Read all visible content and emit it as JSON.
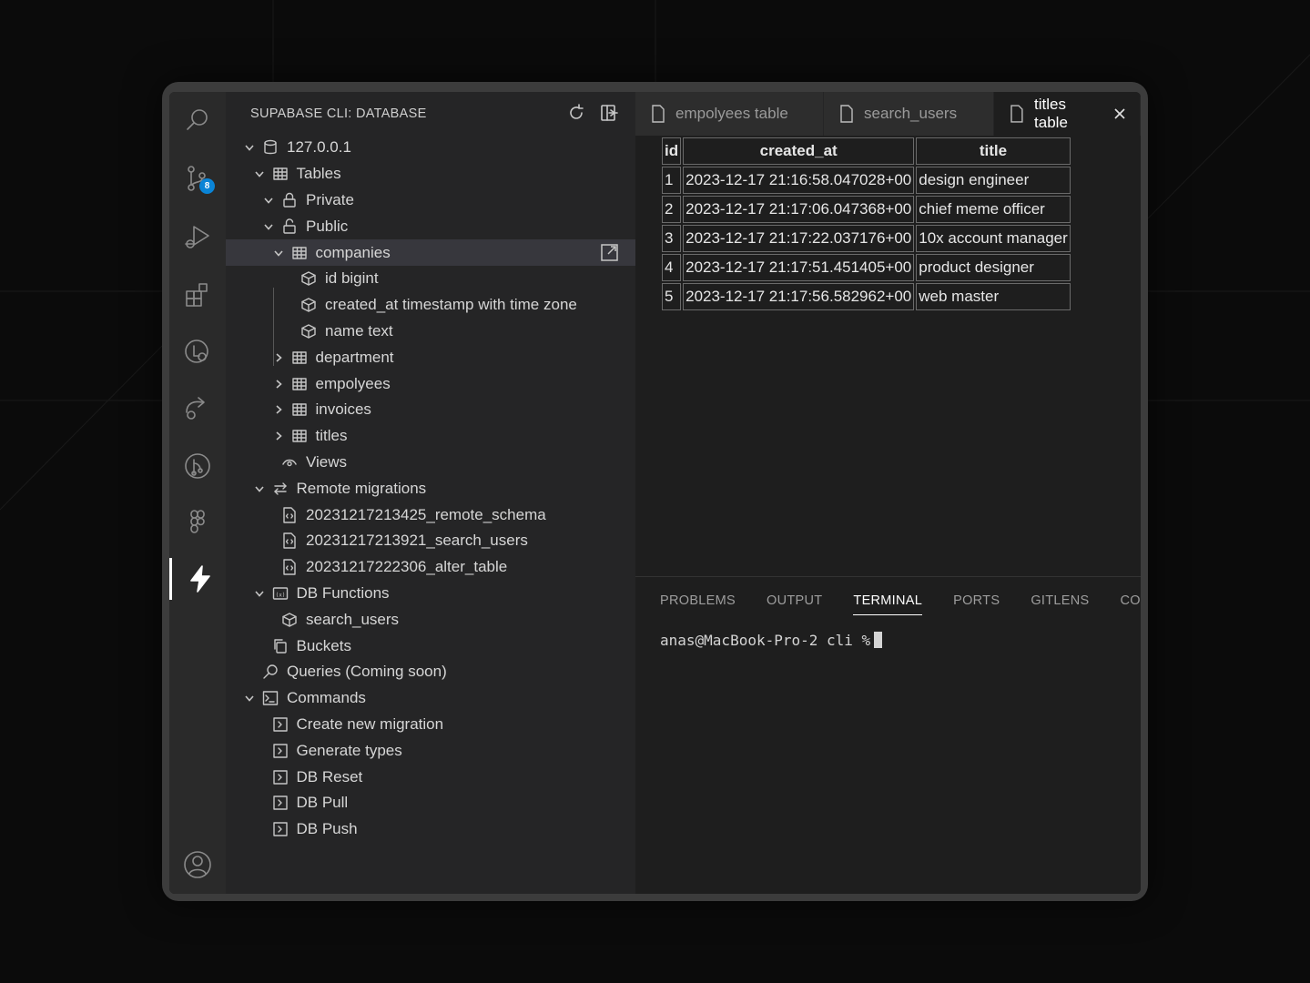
{
  "sidebar": {
    "title": "SUPABASE CLI: DATABASE",
    "tree": [
      {
        "label": "127.0.0.1",
        "icon": "database-icon",
        "chevron": "down",
        "level": 0
      },
      {
        "label": "Tables",
        "icon": "table-icon",
        "chevron": "down",
        "level": 1
      },
      {
        "label": "Private",
        "icon": "lock-icon",
        "chevron": "down",
        "level": 2
      },
      {
        "label": "Public",
        "icon": "unlock-icon",
        "chevron": "down",
        "level": 2
      },
      {
        "label": "companies",
        "icon": "table-icon",
        "chevron": "down",
        "level": 3,
        "selected": true
      },
      {
        "label": "id bigint",
        "icon": "column-icon",
        "chevron": "none",
        "level": 4
      },
      {
        "label": "created_at timestamp with time zone",
        "icon": "column-icon",
        "chevron": "none",
        "level": 4
      },
      {
        "label": "name text",
        "icon": "column-icon",
        "chevron": "none",
        "level": 4
      },
      {
        "label": "department",
        "icon": "table-icon",
        "chevron": "right",
        "level": 3
      },
      {
        "label": "empolyees",
        "icon": "table-icon",
        "chevron": "right",
        "level": 3
      },
      {
        "label": "invoices",
        "icon": "table-icon",
        "chevron": "right",
        "level": 3
      },
      {
        "label": "titles",
        "icon": "table-icon",
        "chevron": "right",
        "level": 3
      },
      {
        "label": "Views",
        "icon": "eye-icon",
        "chevron": "none",
        "level": 2
      },
      {
        "label": "Remote migrations",
        "icon": "arrows-icon",
        "chevron": "down",
        "level": 1
      },
      {
        "label": "20231217213425_remote_schema",
        "icon": "sql-file-icon",
        "chevron": "none",
        "level": 2
      },
      {
        "label": "20231217213921_search_users",
        "icon": "sql-file-icon",
        "chevron": "none",
        "level": 2
      },
      {
        "label": "20231217222306_alter_table",
        "icon": "sql-file-icon",
        "chevron": "none",
        "level": 2
      },
      {
        "label": "DB Functions",
        "icon": "function-icon",
        "chevron": "down",
        "level": 1
      },
      {
        "label": "search_users",
        "icon": "cube-icon",
        "chevron": "none",
        "level": 2
      },
      {
        "label": "Buckets",
        "icon": "copy-icon",
        "chevron": "none",
        "level": 1
      },
      {
        "label": "Queries (Coming soon)",
        "icon": "search-icon",
        "chevron": "none",
        "level": 0
      },
      {
        "label": "Commands",
        "icon": "terminal-icon",
        "chevron": "down",
        "level": 0
      },
      {
        "label": "Create new migration",
        "icon": "command-icon",
        "chevron": "none",
        "level": 1
      },
      {
        "label": "Generate types",
        "icon": "command-icon",
        "chevron": "none",
        "level": 1
      },
      {
        "label": "DB Reset",
        "icon": "command-icon",
        "chevron": "none",
        "level": 1
      },
      {
        "label": "DB Pull",
        "icon": "command-icon",
        "chevron": "none",
        "level": 1
      },
      {
        "label": "DB Push",
        "icon": "command-icon",
        "chevron": "none",
        "level": 1
      }
    ]
  },
  "activity": {
    "scm_badge": "8"
  },
  "tabs": [
    {
      "label": "empolyees table",
      "active": false
    },
    {
      "label": "search_users",
      "active": false
    },
    {
      "label": "titles table",
      "active": true
    }
  ],
  "table": {
    "columns": [
      "id",
      "created_at",
      "title"
    ],
    "rows": [
      [
        "1",
        "2023-12-17 21:16:58.047028+00",
        "design engineer"
      ],
      [
        "2",
        "2023-12-17 21:17:06.047368+00",
        "chief meme officer"
      ],
      [
        "3",
        "2023-12-17 21:17:22.037176+00",
        "10x account manager"
      ],
      [
        "4",
        "2023-12-17 21:17:51.451405+00",
        "product designer"
      ],
      [
        "5",
        "2023-12-17 21:17:56.582962+00",
        "web master"
      ]
    ]
  },
  "panel": {
    "tabs": [
      "PROBLEMS",
      "OUTPUT",
      "TERMINAL",
      "PORTS",
      "GITLENS",
      "COMMI"
    ],
    "active_tab": "TERMINAL",
    "prompt": "anas@MacBook-Pro-2 cli %"
  }
}
